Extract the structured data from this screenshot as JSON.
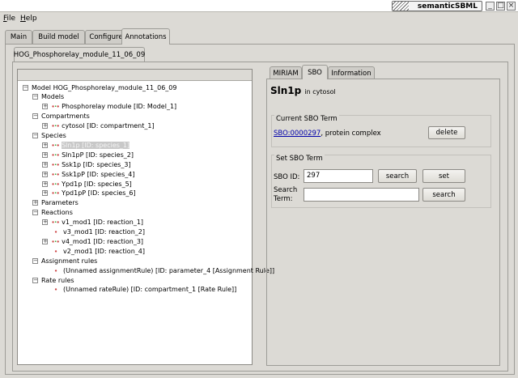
{
  "window": {
    "title": "semanticSBML"
  },
  "menu": [
    {
      "label": "File"
    },
    {
      "label": "Help"
    }
  ],
  "main_tabs": [
    {
      "label": "Main"
    },
    {
      "label": "Build model"
    },
    {
      "label": "Configure"
    },
    {
      "label": "Annotations",
      "active": true
    }
  ],
  "document_tab": {
    "label": "HOG_Phosphorelay_module_11_06_09"
  },
  "tree": {
    "rows": [
      {
        "text": "Model HOG_Phosphorelay_module_11_06_09",
        "level": 0,
        "icon": "collapse"
      },
      {
        "text": "Models",
        "level": 1,
        "icon": "collapse"
      },
      {
        "text": "Phosphorelay module [ID: Model_1]",
        "level": 2,
        "icon": "dots"
      },
      {
        "text": "Compartments",
        "level": 1,
        "icon": "collapse"
      },
      {
        "text": "cytosol [ID: compartment_1]",
        "level": 2,
        "icon": "dots"
      },
      {
        "text": "Species",
        "level": 1,
        "icon": "collapse"
      },
      {
        "text": "Sln1p [ID: species_1]",
        "level": 2,
        "icon": "dots",
        "selected": true
      },
      {
        "text": "Sln1pP [ID: species_2]",
        "level": 2,
        "icon": "dots"
      },
      {
        "text": "Ssk1p [ID: species_3]",
        "level": 2,
        "icon": "dots"
      },
      {
        "text": "Ssk1pP [ID: species_4]",
        "level": 2,
        "icon": "dots"
      },
      {
        "text": "Ypd1p [ID: species_5]",
        "level": 2,
        "icon": "dots"
      },
      {
        "text": "Ypd1pP [ID: species_6]",
        "level": 2,
        "icon": "dots"
      },
      {
        "text": "Parameters",
        "level": 1,
        "icon": "expand"
      },
      {
        "text": "Reactions",
        "level": 1,
        "icon": "collapse"
      },
      {
        "text": "v1_mod1 [ID: reaction_1]",
        "level": 2,
        "icon": "dots"
      },
      {
        "text": "v3_mod1 [ID: reaction_2]",
        "level": 2,
        "icon": "leaf"
      },
      {
        "text": "v4_mod1 [ID: reaction_3]",
        "level": 2,
        "icon": "dots"
      },
      {
        "text": "v2_mod1 [ID: reaction_4]",
        "level": 2,
        "icon": "leaf"
      },
      {
        "text": "Assignment rules",
        "level": 1,
        "icon": "collapse"
      },
      {
        "text": "(Unnamed assignmentRule) [ID: parameter_4 [Assignment Rule]]",
        "level": 2,
        "icon": "leaf"
      },
      {
        "text": "Rate rules",
        "level": 1,
        "icon": "collapse"
      },
      {
        "text": "(Unnamed rateRule) [ID: compartment_1 [Rate Rule]]",
        "level": 2,
        "icon": "leaf"
      }
    ]
  },
  "detail_tabs": [
    {
      "label": "MIRIAM"
    },
    {
      "label": "SBO",
      "active": true
    },
    {
      "label": "Information"
    }
  ],
  "detail": {
    "species_name": "Sln1p",
    "location": "in cytosol",
    "current_group_label": "Current SBO Term",
    "current_term_link": "SBO:0000297",
    "current_term_desc": ", protein complex",
    "delete_label": "delete",
    "set_group_label": "Set SBO Term",
    "sbo_id_label": "SBO ID:",
    "sbo_id_value": "297",
    "search_label": "search",
    "set_label": "set",
    "search_term_label_1": "Search",
    "search_term_label_2": "Term:",
    "search_term_value": "",
    "search2_label": "search"
  }
}
